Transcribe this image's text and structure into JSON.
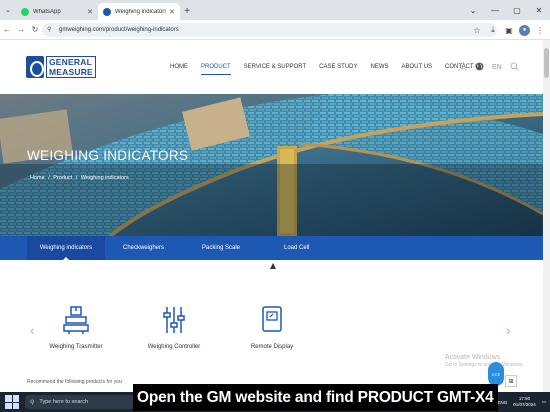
{
  "browser": {
    "tabs": [
      {
        "title": "WhatsApp",
        "active": false,
        "favicon_color": "#25d366"
      },
      {
        "title": "Weighing indicators | Digital W",
        "active": true,
        "favicon_color": "#1b57b4"
      }
    ],
    "url": "gmweighing.com/product/weighing-indicators"
  },
  "site": {
    "logo": {
      "line1": "GENERAL",
      "line2": "MEASURE"
    },
    "nav": [
      {
        "label": "HOME",
        "active": false
      },
      {
        "label": "PRODUCT",
        "active": true
      },
      {
        "label": "SERVICE & SUPPORT",
        "active": false
      },
      {
        "label": "CASE STUDY",
        "active": false
      },
      {
        "label": "NEWS",
        "active": false
      },
      {
        "label": "ABOUT US",
        "active": false
      },
      {
        "label": "CONTACT US",
        "active": false
      }
    ],
    "language": "EN"
  },
  "hero": {
    "title": "WEIGHING INDICATORS",
    "breadcrumb": [
      "Home",
      "/",
      "Product",
      "/",
      "Weighing indicators"
    ]
  },
  "subnav": [
    {
      "label": "Weighing indicators",
      "active": true
    },
    {
      "label": "Checkweighers",
      "active": false
    },
    {
      "label": "Packing Scale",
      "active": false
    },
    {
      "label": "Load Cell",
      "active": false
    }
  ],
  "categories": [
    {
      "label": "Weighing Trasmitter",
      "icon": "transmitter-icon"
    },
    {
      "label": "Weighing Controller",
      "icon": "controller-icon"
    },
    {
      "label": "Remote Display",
      "icon": "display-icon"
    }
  ],
  "recommend_text": "Recommend the following products for you",
  "watermark": {
    "line1": "Activate Windows",
    "line2": "Go to Settings to activate Windows."
  },
  "chat_label": "GCE",
  "taskbar": {
    "search_placeholder": "Type here to search",
    "lang": "ENG",
    "time": "17:50",
    "date": "01/07/2024"
  },
  "caption": "Open the GM website and find PRODUCT GMT-X4",
  "colors": {
    "brand_blue": "#1d58b3",
    "active_nav": "#1b57b4"
  }
}
